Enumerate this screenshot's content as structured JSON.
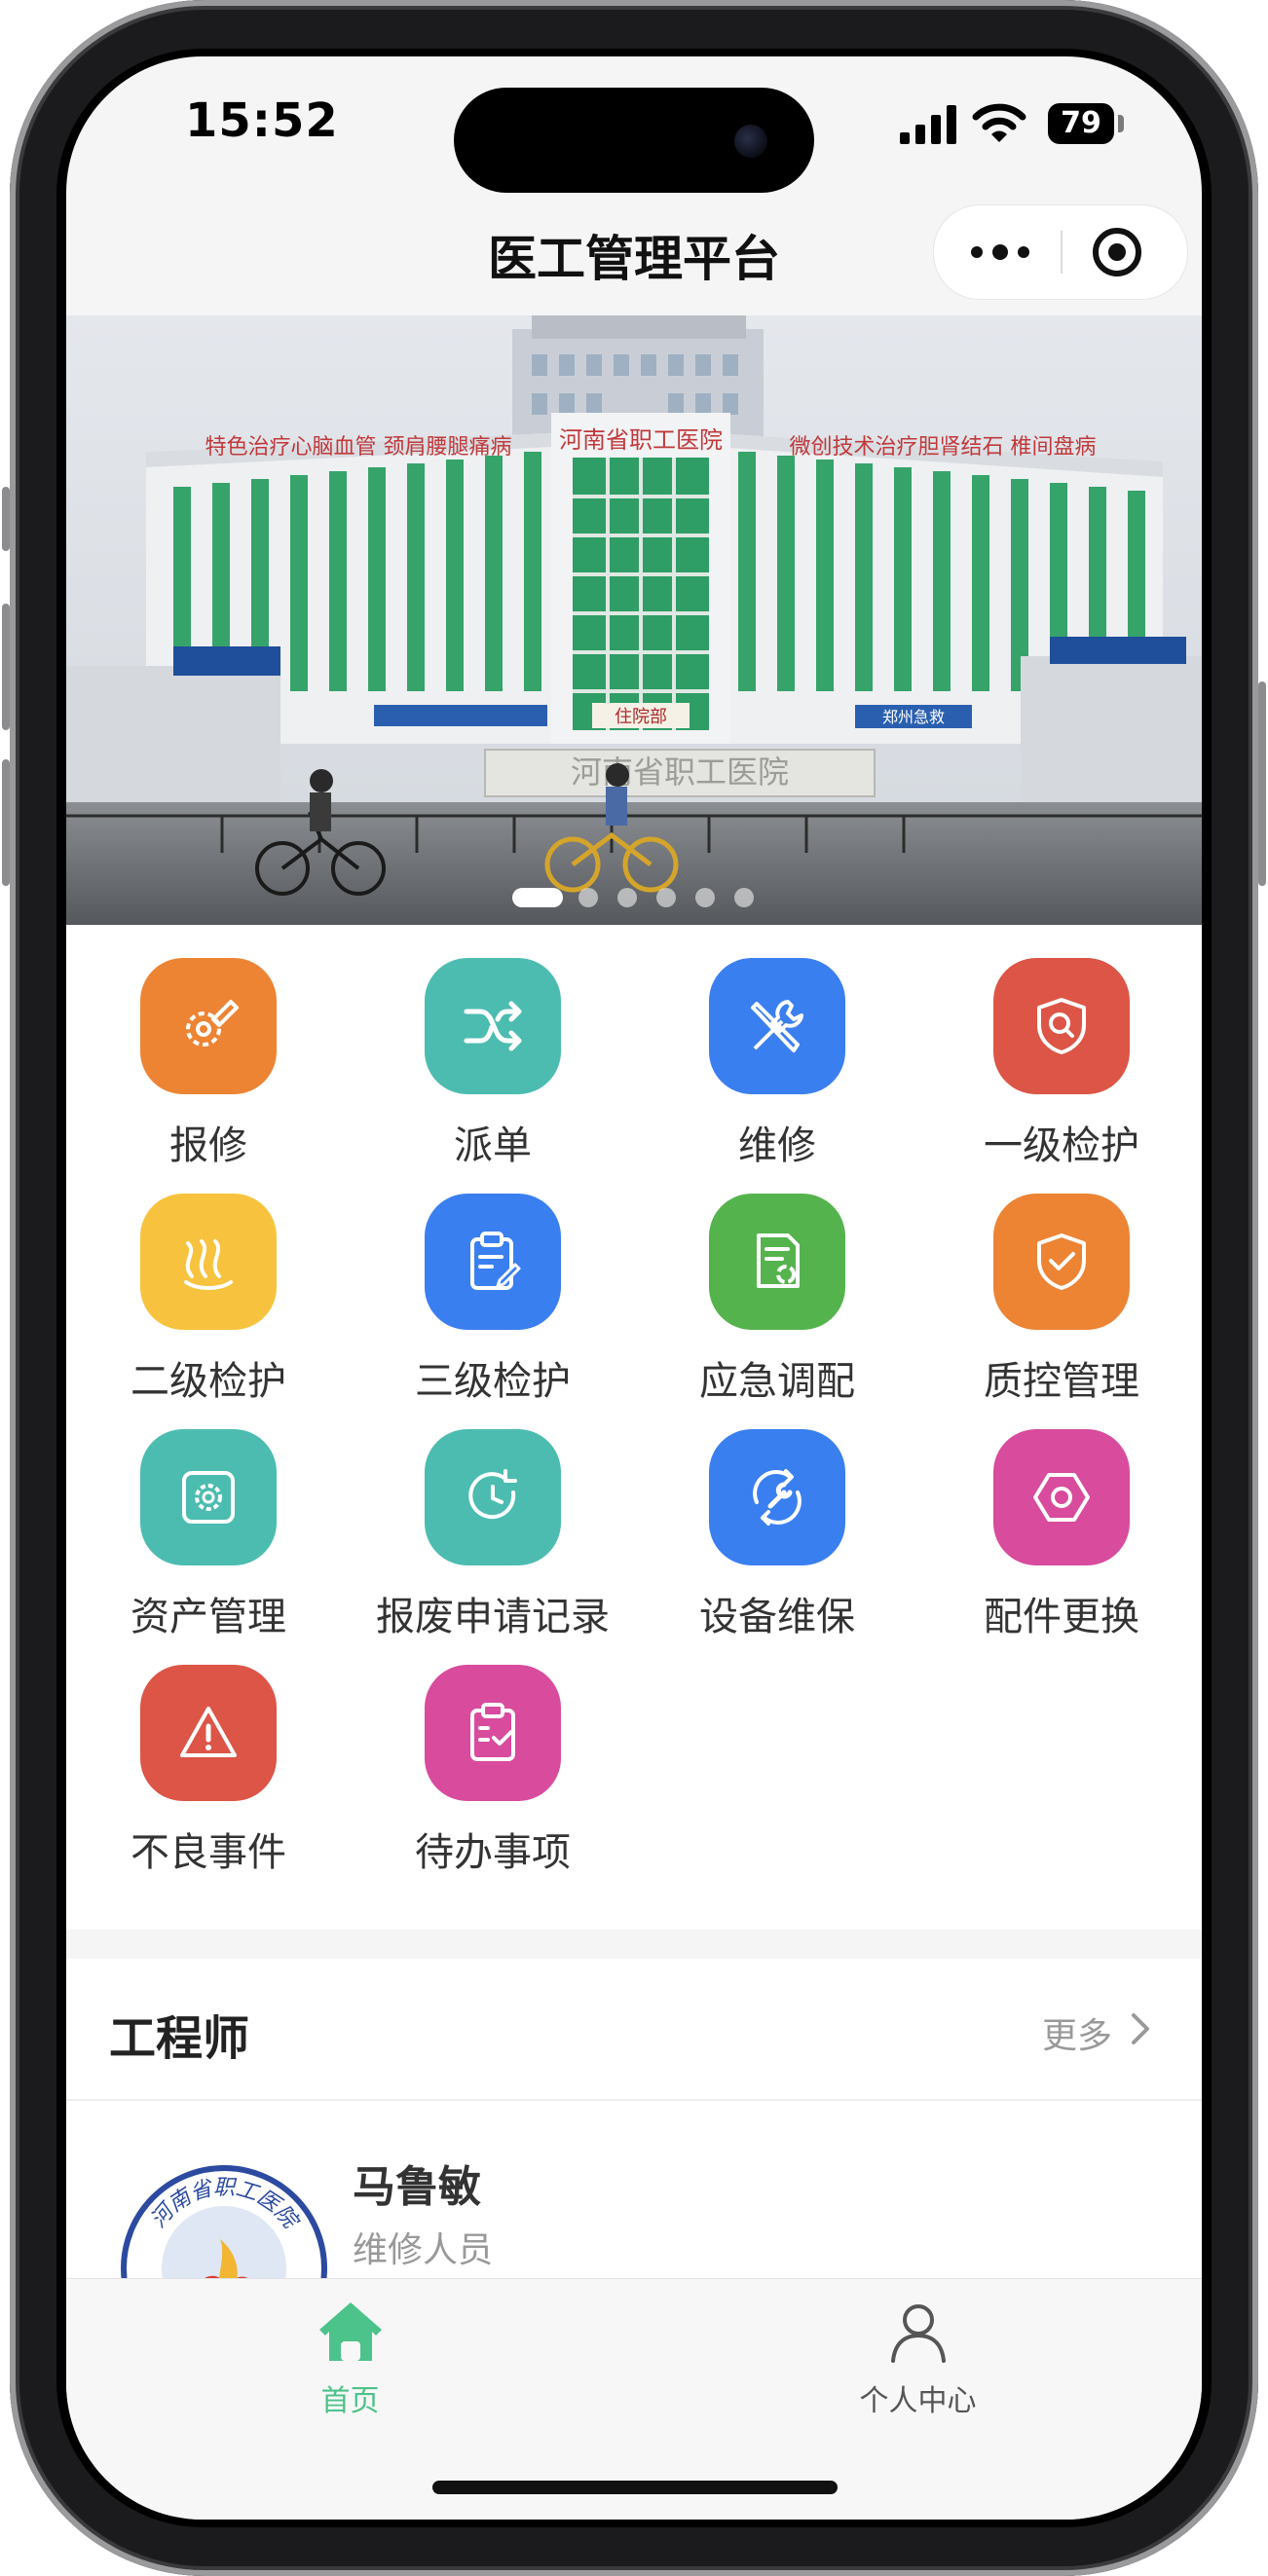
{
  "status_bar": {
    "time": "15:52",
    "battery": "79"
  },
  "nav": {
    "title": "医工管理平台"
  },
  "banner": {
    "slide_count": 6,
    "active_index": 0,
    "building_signs": {
      "left": "特色治疗心脑血管 颈肩腰腿痛病",
      "center": "河南省职工医院",
      "right": "微创技术治疗胆肾结石 椎间盘病",
      "entrance": "住院部",
      "gate": "河南省职工医院",
      "kiosk": "郑州急救"
    }
  },
  "grid": [
    {
      "label": "报修",
      "icon": "gear-pencil-icon",
      "color": "#ec8434"
    },
    {
      "label": "派单",
      "icon": "shuffle-icon",
      "color": "#4cbcb0"
    },
    {
      "label": "维修",
      "icon": "tools-icon",
      "color": "#3a7ff0"
    },
    {
      "label": "一级检护",
      "icon": "shield-search-icon",
      "color": "#dc5546"
    },
    {
      "label": "二级检护",
      "icon": "heat-waves-icon",
      "color": "#f7c33e"
    },
    {
      "label": "三级检护",
      "icon": "clipboard-edit-icon",
      "color": "#3a7ff0"
    },
    {
      "label": "应急调配",
      "icon": "document-recycle-icon",
      "color": "#55b34e"
    },
    {
      "label": "质控管理",
      "icon": "shield-check-icon",
      "color": "#ec8434"
    },
    {
      "label": "资产管理",
      "icon": "settings-box-icon",
      "color": "#4cbcb0"
    },
    {
      "label": "报废申请记录",
      "icon": "history-clock-icon",
      "color": "#4cbcb0"
    },
    {
      "label": "设备维保",
      "icon": "wrench-cycle-icon",
      "color": "#3a7ff0"
    },
    {
      "label": "配件更换",
      "icon": "hex-nut-icon",
      "color": "#d84b9d"
    },
    {
      "label": "不良事件",
      "icon": "warning-icon",
      "color": "#dc5546"
    },
    {
      "label": "待办事项",
      "icon": "checklist-icon",
      "color": "#d84b9d"
    }
  ],
  "engineers": {
    "title": "工程师",
    "more_label": "更多",
    "items": [
      {
        "name": "马鲁敏",
        "role": "维修人员",
        "avatar_text": "河南省职工医院"
      }
    ]
  },
  "tabbar": {
    "tabs": [
      {
        "label": "首页",
        "icon": "home-icon",
        "active": true
      },
      {
        "label": "个人中心",
        "icon": "person-icon",
        "active": false
      }
    ]
  },
  "colors": {
    "accent": "#4cc38a",
    "tab_inactive": "#555555"
  }
}
